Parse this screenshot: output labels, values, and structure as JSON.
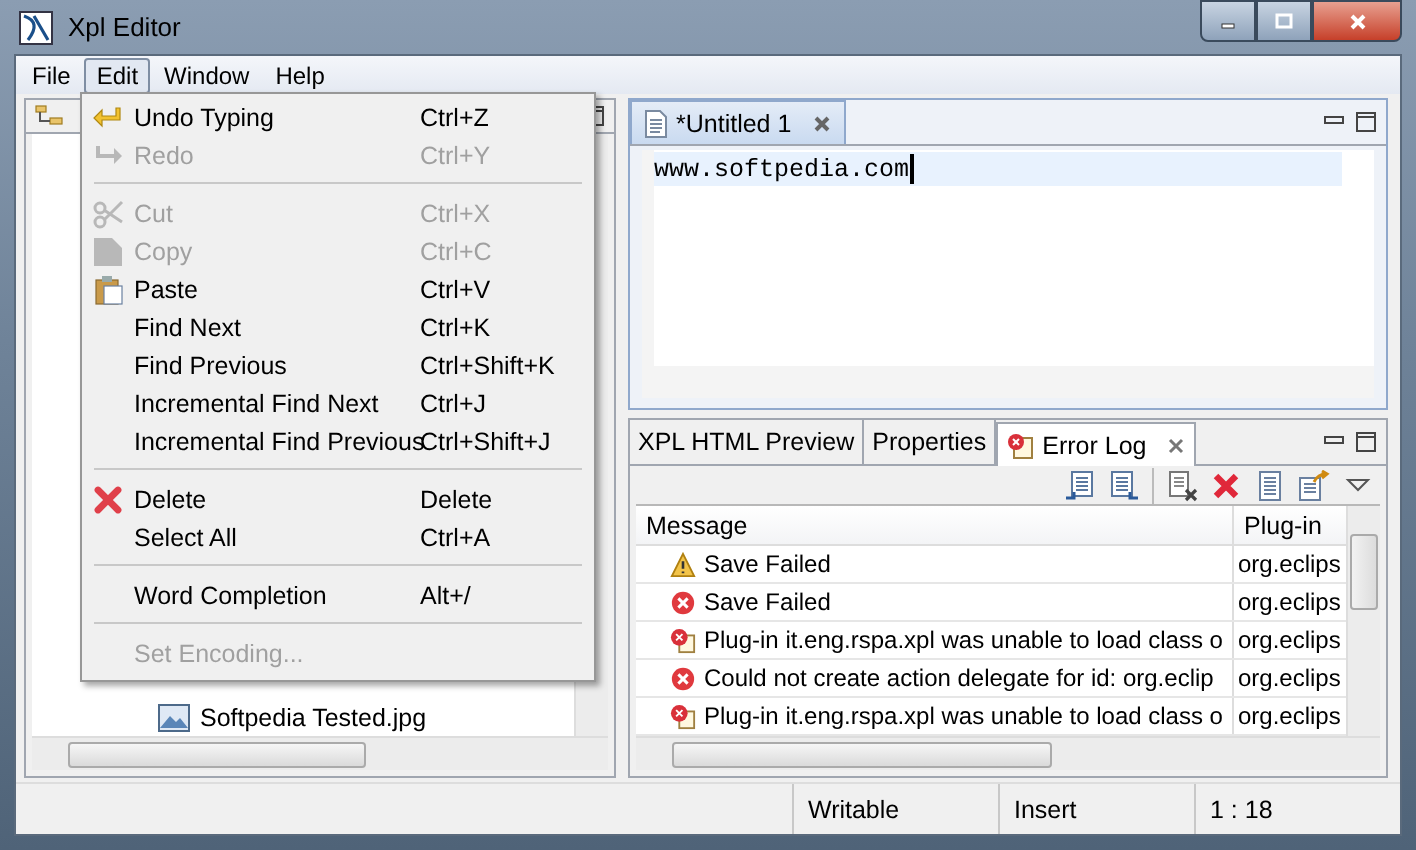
{
  "window": {
    "title": "Xpl Editor"
  },
  "menubar": [
    {
      "label": "File",
      "selected": false
    },
    {
      "label": "Edit",
      "selected": true
    },
    {
      "label": "Window",
      "selected": false
    },
    {
      "label": "Help",
      "selected": false
    }
  ],
  "edit_menu": [
    {
      "kind": "undo",
      "label": "Undo Typing",
      "shortcut": "Ctrl+Z",
      "disabled": false
    },
    {
      "kind": "redo",
      "label": "Redo",
      "shortcut": "Ctrl+Y",
      "disabled": true
    },
    {
      "kind": "separator"
    },
    {
      "kind": "cut",
      "label": "Cut",
      "shortcut": "Ctrl+X",
      "disabled": true
    },
    {
      "kind": "copy",
      "label": "Copy",
      "shortcut": "Ctrl+C",
      "disabled": true
    },
    {
      "kind": "paste",
      "label": "Paste",
      "shortcut": "Ctrl+V",
      "disabled": false
    },
    {
      "kind": "plain",
      "label": "Find Next",
      "shortcut": "Ctrl+K",
      "disabled": false
    },
    {
      "kind": "plain",
      "label": "Find Previous",
      "shortcut": "Ctrl+Shift+K",
      "disabled": false
    },
    {
      "kind": "plain",
      "label": "Incremental Find Next",
      "shortcut": "Ctrl+J",
      "disabled": false
    },
    {
      "kind": "plain",
      "label": "Incremental Find Previous",
      "shortcut": "Ctrl+Shift+J",
      "disabled": false
    },
    {
      "kind": "separator"
    },
    {
      "kind": "delete",
      "label": "Delete",
      "shortcut": "Delete",
      "disabled": false
    },
    {
      "kind": "plain",
      "label": "Select All",
      "shortcut": "Ctrl+A",
      "disabled": false
    },
    {
      "kind": "separator"
    },
    {
      "kind": "plain",
      "label": "Word Completion",
      "shortcut": "Alt+/",
      "disabled": false
    },
    {
      "kind": "separator"
    },
    {
      "kind": "plain",
      "label": "Set Encoding...",
      "disabled": true
    }
  ],
  "navigator": {
    "tree": [
      {
        "label": "Softpedia Tested.jpg"
      }
    ]
  },
  "editor": {
    "tabs": [
      {
        "label": "*Untitled 1",
        "selected": true
      }
    ],
    "text": "www.softpedia.com"
  },
  "bottom_panel": {
    "tabs": [
      {
        "label": "XPL HTML Preview",
        "selected": false
      },
      {
        "label": "Properties",
        "selected": false
      },
      {
        "label": "Error Log",
        "selected": true
      }
    ],
    "table": {
      "columns": [
        "Message",
        "Plug-in"
      ],
      "rows": [
        {
          "kind": "warning",
          "message": "Save Failed",
          "plugin": "org.eclips"
        },
        {
          "kind": "error",
          "message": "Save Failed",
          "plugin": "org.eclips"
        },
        {
          "kind": "plugin-error",
          "message": "Plug-in it.eng.rspa.xpl was unable to load class o",
          "plugin": "org.eclips"
        },
        {
          "kind": "error",
          "message": "Could not create action delegate for id: org.eclip",
          "plugin": "org.eclips"
        },
        {
          "kind": "plugin-error",
          "message": "Plug-in it.eng.rspa.xpl was unable to load class o",
          "plugin": "org.eclips"
        }
      ]
    }
  },
  "status_bar": [
    "Writable",
    "Insert",
    "1 : 18"
  ]
}
